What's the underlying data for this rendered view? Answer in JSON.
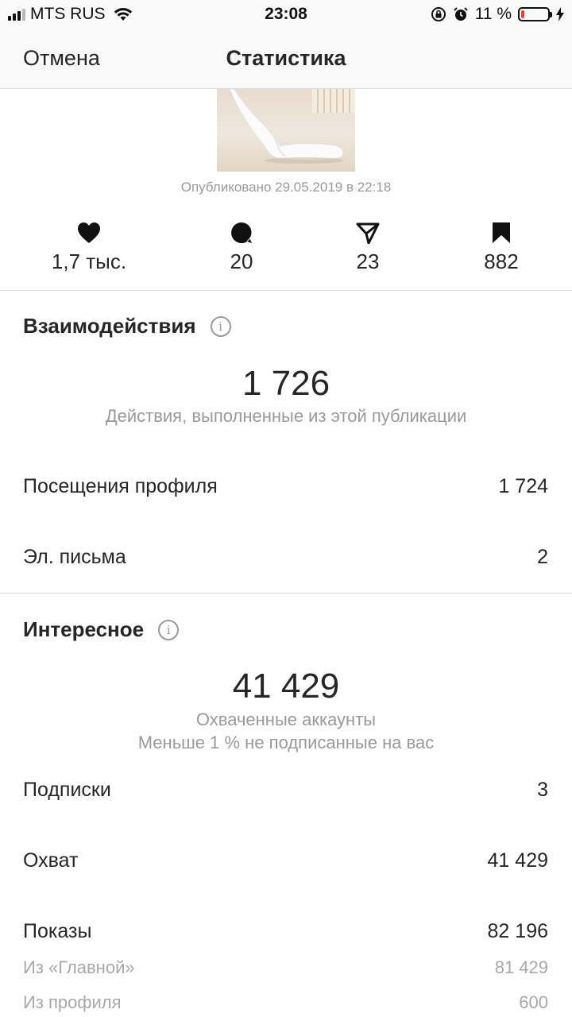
{
  "status_bar": {
    "carrier": "MTS RUS",
    "time": "23:08",
    "battery": "11 %",
    "battery_level": 0.11,
    "battery_color": "#ff3b30"
  },
  "nav": {
    "cancel": "Отмена",
    "title": "Статистика"
  },
  "post": {
    "published": "Опубликовано 29.05.2019 в 22:18"
  },
  "stats": [
    {
      "icon": "heart-icon",
      "value": "1,7 тыс."
    },
    {
      "icon": "comment-icon",
      "value": "20"
    },
    {
      "icon": "share-icon",
      "value": "23"
    },
    {
      "icon": "bookmark-icon",
      "value": "882"
    }
  ],
  "interactions": {
    "title": "Взаимодействия",
    "total": "1 726",
    "description": "Действия, выполненные из этой публикации",
    "rows": [
      {
        "label": "Посещения профиля",
        "value": "1 724"
      },
      {
        "label": "Эл. письма",
        "value": "2"
      }
    ]
  },
  "discovery": {
    "title": "Интересное",
    "total": "41 429",
    "description": "Охваченные аккаунты",
    "note": "Меньше 1 % не подписанные на вас",
    "rows": [
      {
        "label": "Подписки",
        "value": "3"
      },
      {
        "label": "Охват",
        "value": "41 429"
      },
      {
        "label": "Показы",
        "value": "82 196"
      }
    ],
    "sub_rows": [
      {
        "label": "Из «Главной»",
        "value": "81 429"
      },
      {
        "label": "Из профиля",
        "value": "600"
      }
    ]
  }
}
